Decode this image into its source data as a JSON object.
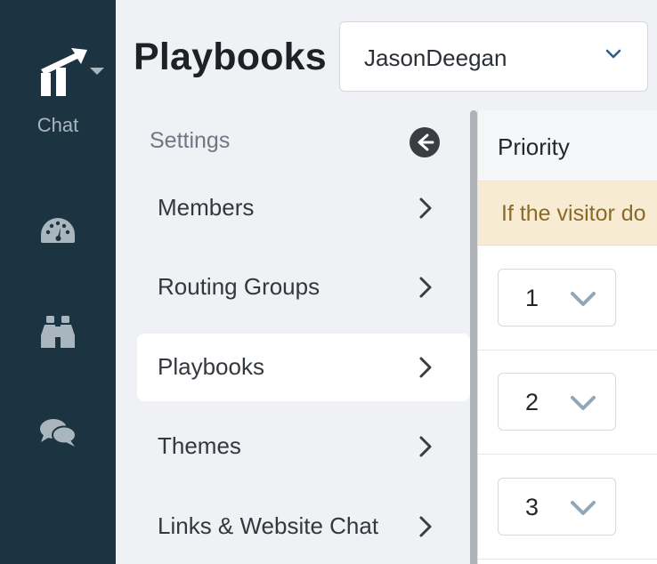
{
  "sidebar": {
    "brand": {
      "label": "Chat",
      "logo_icon": "brand-chart-arrow-icon"
    },
    "nav": [
      {
        "name": "dashboard",
        "icon": "speedometer-icon"
      },
      {
        "name": "monitor",
        "icon": "binoculars-icon"
      },
      {
        "name": "conversations",
        "icon": "chat-bubbles-icon"
      }
    ]
  },
  "header": {
    "title": "Playbooks",
    "account_select": {
      "value": "JasonDeegan"
    }
  },
  "settings_menu": {
    "title": "Settings",
    "items": [
      {
        "label": "Members",
        "active": false
      },
      {
        "label": "Routing Groups",
        "active": false
      },
      {
        "label": "Playbooks",
        "active": true
      },
      {
        "label": "Themes",
        "active": false
      },
      {
        "label": "Links & Website Chat",
        "active": false
      }
    ]
  },
  "priority_panel": {
    "header": "Priority",
    "notice": "If the visitor do",
    "rows": [
      {
        "priority": "1"
      },
      {
        "priority": "2"
      },
      {
        "priority": "3"
      }
    ]
  },
  "colors": {
    "rail": "#1c3442",
    "rail_icon": "#aab6be",
    "notice_bg": "#f7ecd3",
    "notice_text": "#8a6a26",
    "chevron_blue": "#8fa7bb"
  }
}
